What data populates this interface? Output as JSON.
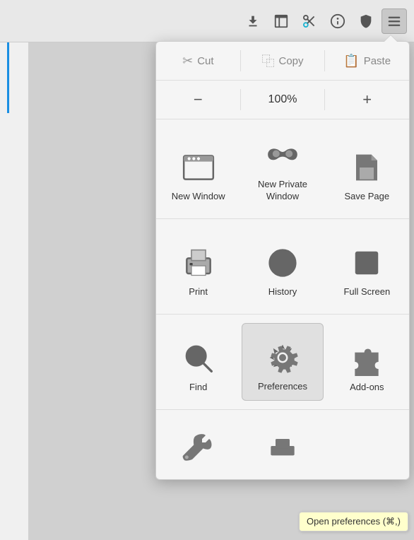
{
  "toolbar": {
    "icons": [
      "download",
      "panel",
      "scissors-tool",
      "info",
      "shield",
      "menu"
    ]
  },
  "clipboard": {
    "cut_label": "Cut",
    "copy_label": "Copy",
    "paste_label": "Paste"
  },
  "zoom": {
    "decrease_label": "−",
    "value": "100%",
    "increase_label": "+"
  },
  "menu_items": {
    "row1": [
      {
        "id": "new-window",
        "label": "New Window"
      },
      {
        "id": "new-private-window",
        "label": "New Private\nWindow"
      },
      {
        "id": "save-page",
        "label": "Save Page"
      }
    ],
    "row2": [
      {
        "id": "print",
        "label": "Print"
      },
      {
        "id": "history",
        "label": "History"
      },
      {
        "id": "full-screen",
        "label": "Full Screen"
      }
    ],
    "row3": [
      {
        "id": "find",
        "label": "Find"
      },
      {
        "id": "preferences",
        "label": "Preferences",
        "highlighted": true
      },
      {
        "id": "add-ons",
        "label": "Add-ons"
      }
    ],
    "row4": [
      {
        "id": "tools",
        "label": ""
      },
      {
        "id": "screenshot",
        "label": ""
      }
    ]
  },
  "tooltip": {
    "text": "Open preferences (⌘,)"
  }
}
